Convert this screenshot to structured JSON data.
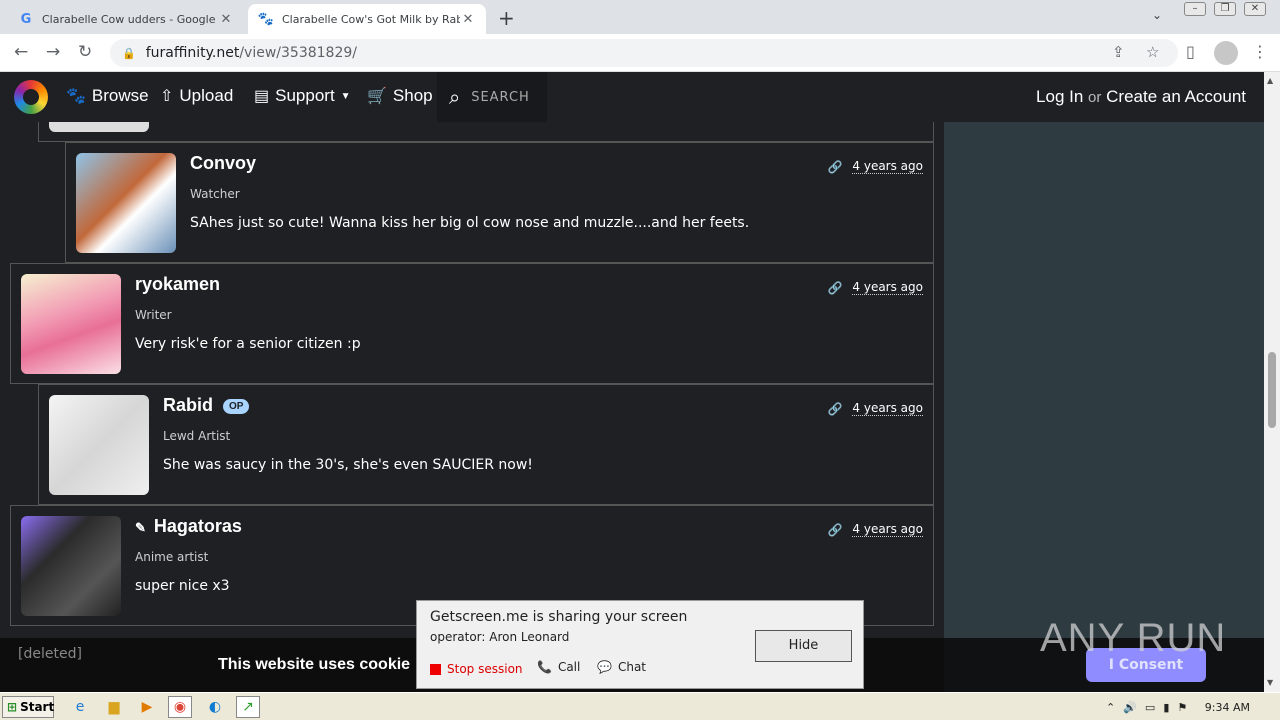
{
  "browser": {
    "tabs": [
      {
        "title": "Clarabelle Cow udders - Google Sear",
        "favicon": "google-icon",
        "active": false
      },
      {
        "title": "Clarabelle Cow's Got Milk by Rabid --",
        "favicon": "paw-icon",
        "active": true
      }
    ],
    "url_host": "furaffinity.net",
    "url_path": "/view/35381829/"
  },
  "site_nav": {
    "browse": "Browse",
    "upload": "Upload",
    "support": "Support",
    "shop": "Shop",
    "search": "SEARCH",
    "login": "Log In",
    "or": "or",
    "create": "Create an Account"
  },
  "comments": [
    {
      "name": "Convoy",
      "role": "Watcher",
      "time": "4 years ago",
      "body": "SAhes just so cute! Wanna kiss her big ol cow nose and muzzle....and her feets."
    },
    {
      "name": "ryokamen",
      "role": "Writer",
      "time": "4 years ago",
      "body": "Very risk'e for a senior citizen :p"
    },
    {
      "name": "Rabid",
      "badge": "OP",
      "role": "Lewd Artist",
      "time": "4 years ago",
      "body": "She was saucy in the 30's, she's even SAUCIER now!"
    },
    {
      "name": "Hagatoras",
      "role": "Anime artist",
      "time": "4 years ago",
      "body": "super nice x3"
    }
  ],
  "cookie": {
    "deleted": "[deleted]",
    "message": "This website uses cookie",
    "consent": "I Consent"
  },
  "watermark": "ANY RUN",
  "popup": {
    "title": "Getscreen.me is sharing your screen",
    "operator": "operator: Aron Leonard",
    "stop": "Stop session",
    "call": "Call",
    "chat": "Chat",
    "hide": "Hide"
  },
  "taskbar": {
    "start": "Start",
    "clock": "9:34 AM"
  }
}
